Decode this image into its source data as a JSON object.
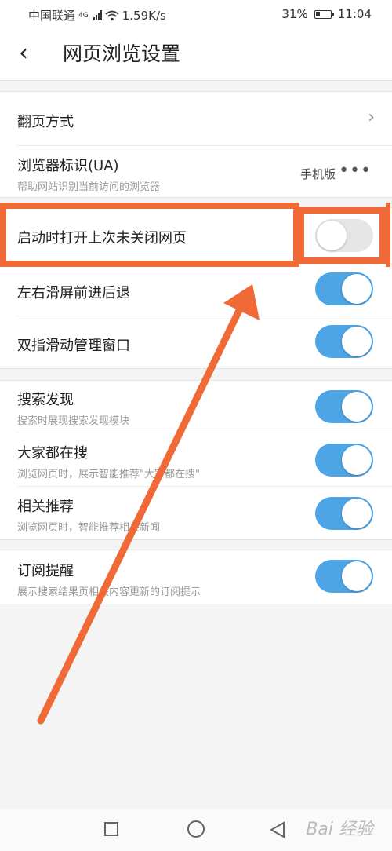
{
  "status_bar": {
    "carrier": "中国联通",
    "network_type": "4G",
    "speed": "1.59K/s",
    "battery_percent": "31%",
    "time": "11:04",
    "battery_level": 0.31
  },
  "header": {
    "back_icon": "‹",
    "title": "网页浏览设置"
  },
  "settings": {
    "page_turn": {
      "label": "翻页方式",
      "chevron": "›"
    },
    "user_agent": {
      "label": "浏览器标识(UA)",
      "sub": "帮助网站识别当前访问的浏览器",
      "value": "手机版",
      "more": "•••"
    },
    "restore_pages": {
      "label": "启动时打开上次未关闭网页",
      "enabled": false
    },
    "swipe_nav": {
      "label": "左右滑屏前进后退",
      "enabled": true
    },
    "two_finger": {
      "label": "双指滑动管理窗口",
      "enabled": true
    },
    "search_discover": {
      "label": "搜索发现",
      "sub": "搜索时展现搜索发现模块",
      "enabled": true
    },
    "everyone_search": {
      "label": "大家都在搜",
      "sub": "浏览网页时，展示智能推荐\"大家都在搜\"",
      "enabled": true
    },
    "related": {
      "label": "相关推荐",
      "sub": "浏览网页时，智能推荐相关新闻",
      "enabled": true
    },
    "subscription": {
      "label": "订阅提醒",
      "sub": "展示搜索结果页相关内容更新的订阅提示",
      "enabled": true
    }
  },
  "annotation": {
    "color": "#f06a38"
  },
  "watermark": "Bai 经验",
  "colors": {
    "toggle_on": "#4da5e6",
    "toggle_off": "#e6e6e6",
    "highlight": "#f06a38"
  }
}
